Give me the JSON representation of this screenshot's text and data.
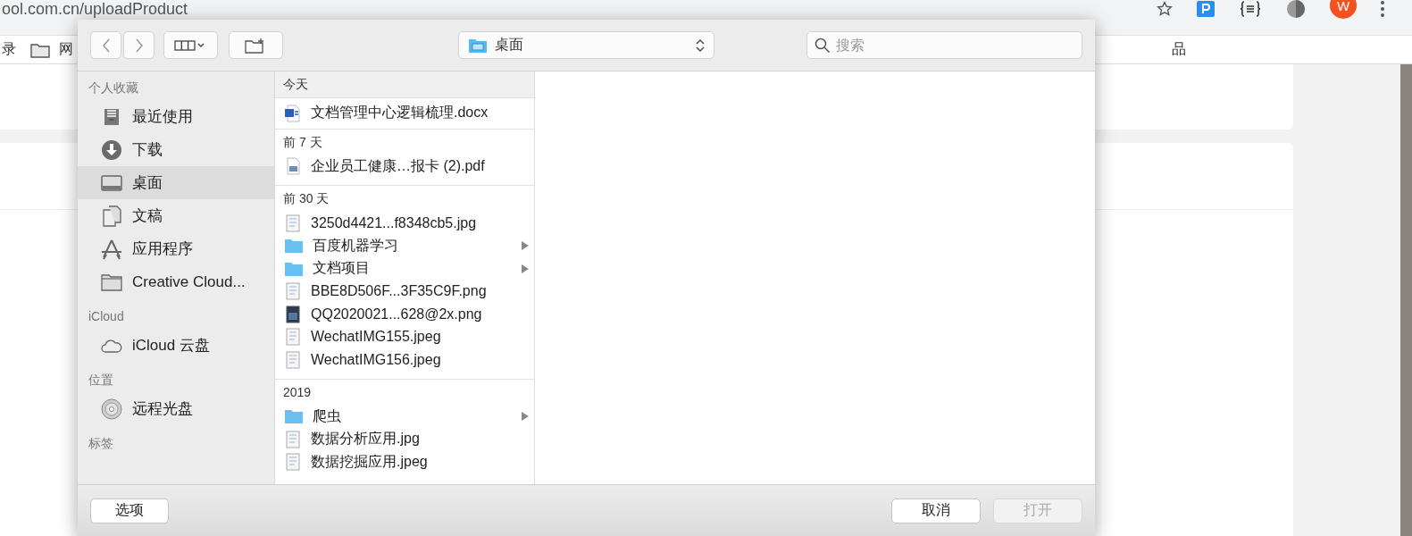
{
  "browser": {
    "address": "ool.com.cn/uploadProduct",
    "avatar": "W",
    "bookmarks": [
      {
        "label": "录",
        "kind": "text"
      },
      {
        "label": "网",
        "kind": "folder"
      }
    ],
    "bookmark_right": "品"
  },
  "dialog": {
    "location": "桌面",
    "search": {
      "placeholder": "搜索"
    },
    "sidebar": [
      {
        "heading": "个人收藏",
        "items": [
          {
            "label": "最近使用",
            "kind": "recents",
            "selected": false
          },
          {
            "label": "下载",
            "kind": "downloads",
            "selected": false
          },
          {
            "label": "桌面",
            "kind": "desktop",
            "selected": true
          },
          {
            "label": "文稿",
            "kind": "documents",
            "selected": false
          },
          {
            "label": "应用程序",
            "kind": "applications",
            "selected": false
          },
          {
            "label": "Creative Cloud...",
            "kind": "folder",
            "selected": false
          }
        ]
      },
      {
        "heading": "iCloud",
        "items": [
          {
            "label": "iCloud 云盘",
            "kind": "cloud",
            "selected": false
          }
        ]
      },
      {
        "heading": "位置",
        "items": [
          {
            "label": "远程光盘",
            "kind": "disc",
            "selected": false
          }
        ]
      },
      {
        "heading": "标签"
      }
    ],
    "groups": [
      {
        "heading": "今天",
        "files": [
          {
            "name": "文档管理中心逻辑梳理.docx",
            "kind": "word"
          }
        ]
      },
      {
        "heading": "前 7 天",
        "files": [
          {
            "name": "企业员工健康…报卡 (2).pdf",
            "kind": "pdf"
          }
        ]
      },
      {
        "heading": "前 30 天",
        "files": [
          {
            "name": "3250d4421...f8348cb5.jpg",
            "kind": "image"
          },
          {
            "name": "百度机器学习",
            "kind": "folder"
          },
          {
            "name": "文档项目",
            "kind": "folder"
          },
          {
            "name": "BBE8D506F...3F35C9F.png",
            "kind": "image"
          },
          {
            "name": "QQ2020021...628@2x.png",
            "kind": "image-dark"
          },
          {
            "name": "WechatIMG155.jpeg",
            "kind": "image"
          },
          {
            "name": "WechatIMG156.jpeg",
            "kind": "image"
          }
        ]
      },
      {
        "heading": "2019",
        "files": [
          {
            "name": "爬虫",
            "kind": "folder"
          },
          {
            "name": "数据分析应用.jpg",
            "kind": "image"
          },
          {
            "name": "数据挖掘应用.jpeg",
            "kind": "image"
          }
        ]
      }
    ],
    "buttons": {
      "options": "选项",
      "cancel": "取消",
      "open": {
        "label": "打开",
        "disabled": true
      }
    }
  }
}
